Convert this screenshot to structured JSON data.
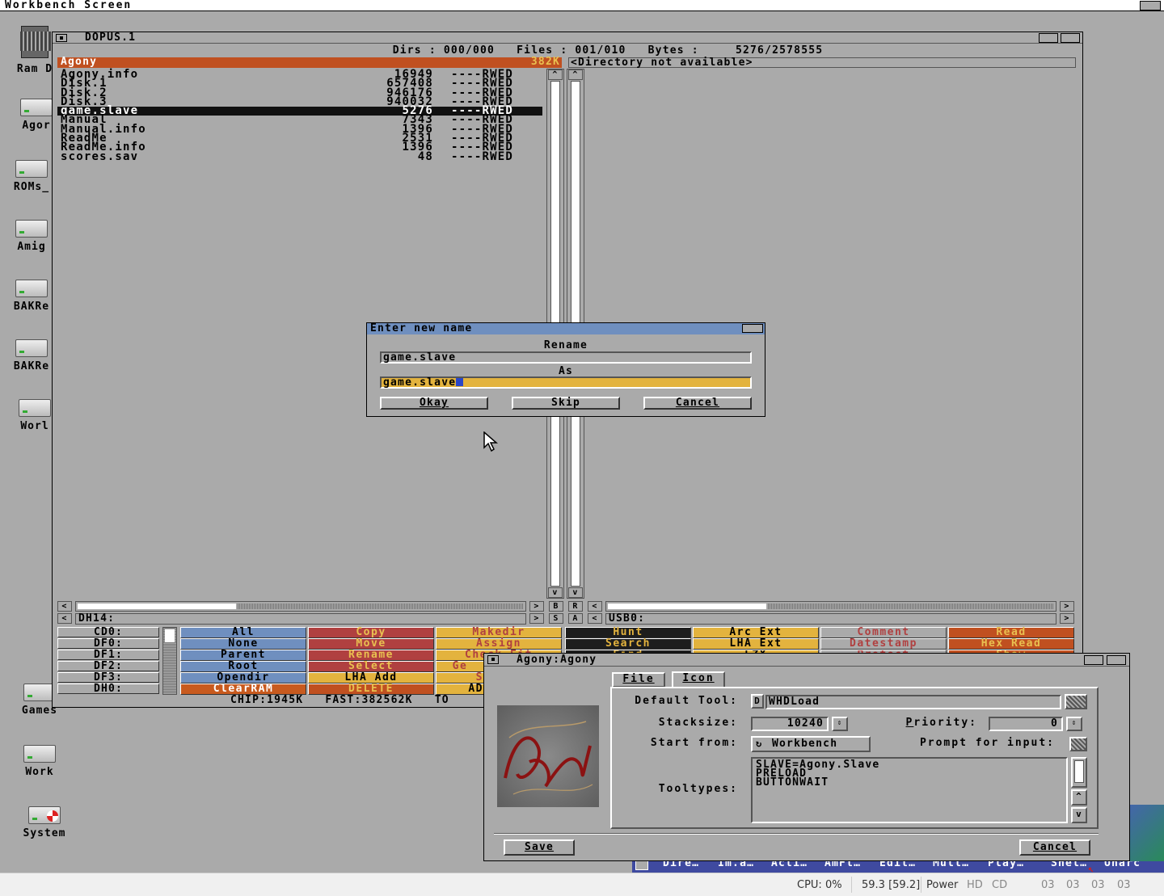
{
  "screen": {
    "title": "Workbench Screen"
  },
  "desktop_icons": [
    {
      "label": "Ram D",
      "icon": "ram-disk-icon"
    },
    {
      "label": "Agor",
      "icon": "harddisk-icon"
    },
    {
      "label": "ROMs_",
      "icon": "harddisk-icon"
    },
    {
      "label": "Amig",
      "icon": "harddisk-icon"
    },
    {
      "label": "BAKRe",
      "icon": "harddisk-icon"
    },
    {
      "label": "BAKRe",
      "icon": "harddisk-icon"
    },
    {
      "label": "Worl",
      "icon": "harddisk-icon"
    },
    {
      "label": "Games",
      "icon": "harddisk-icon"
    },
    {
      "label": "Work",
      "icon": "harddisk-icon"
    },
    {
      "label": "System",
      "icon": "system-disk-icon"
    }
  ],
  "dopus": {
    "title": "DOPUS.1",
    "status": "Dirs : 000/000   Files : 001/010   Bytes :     5276/2578555",
    "left_header": {
      "name": "Agony",
      "size": "382K"
    },
    "right_header": "<Directory not available>",
    "files": [
      {
        "name": "Agony.info",
        "size": "16949",
        "prot": "----RWED"
      },
      {
        "name": "Disk.1",
        "size": "657408",
        "prot": "----RWED"
      },
      {
        "name": "Disk.2",
        "size": "946176",
        "prot": "----RWED"
      },
      {
        "name": "Disk.3",
        "size": "940032",
        "prot": "----RWED"
      },
      {
        "name": "game.slave",
        "size": "5276",
        "prot": "----RWED",
        "selected": true
      },
      {
        "name": "Manual",
        "size": "7343",
        "prot": "----RWED"
      },
      {
        "name": "Manual.info",
        "size": "1396",
        "prot": "----RWED"
      },
      {
        "name": "ReadMe",
        "size": "2531",
        "prot": "----RWED"
      },
      {
        "name": "ReadMe.info",
        "size": "1396",
        "prot": "----RWED"
      },
      {
        "name": "scores.sav",
        "size": "48",
        "prot": "----RWED"
      }
    ],
    "left_path": "DH14:",
    "right_path": "USB0:",
    "mid_buttons": {
      "b": "B",
      "r": "R",
      "s": "S",
      "a": "A"
    },
    "drives": [
      "CD0:",
      "DF0:",
      "DF1:",
      "DF2:",
      "DF3:",
      "DH0:"
    ],
    "buttons": {
      "col1": [
        "All",
        "None",
        "Parent",
        "Root",
        "Opendir",
        "ClearRAM"
      ],
      "col2": [
        "Copy",
        "Move",
        "Rename",
        "Select",
        "LHA Add",
        "DELETE"
      ],
      "col3": [
        "Makedir",
        "Assign",
        "Check Fit",
        "Ge",
        "S",
        "AD"
      ],
      "col4": [
        "Hunt",
        "Search",
        "Find"
      ],
      "col5": [
        "Arc Ext",
        "LHA Ext",
        "LZX"
      ],
      "col6": [
        "Comment",
        "Datestamp",
        "Protect"
      ],
      "col7": [
        "Read",
        "Hex Read",
        "Show"
      ]
    },
    "memory": "CHIP:1945K   FAST:382562K   TO"
  },
  "dialog": {
    "title": "Enter new name",
    "rename_label": "Rename",
    "old_name": "game.slave",
    "as_label": "As",
    "new_name": "game.slave",
    "okay": "Okay",
    "skip": "Skip",
    "cancel": "Cancel"
  },
  "icon_window": {
    "title": "Agony:Agony",
    "tabs": [
      "File",
      "Icon"
    ],
    "default_tool_label": "Default Tool:",
    "default_tool": "WHDLoad",
    "stacksize_label": "Stacksize:",
    "stacksize": "10240",
    "priority_label": "Priority:",
    "priority": "0",
    "start_from_label": "Start from:",
    "start_from": "Workbench",
    "prompt_label": "Prompt for input:",
    "tooltypes_label": "Tooltypes:",
    "tooltypes": [
      "SLAVE=Agony.Slave",
      "PRELOAD",
      "BUTTONWAIT"
    ],
    "save": "Save",
    "cancel": "Cancel",
    "icon_image_text": "Agony"
  },
  "bottom_dock": [
    "Dire…",
    "Im.a…",
    "Acti…",
    "AmFt…",
    "Edit…",
    "Mult…",
    "Play…",
    "Shel…",
    "Unarc"
  ],
  "taskbar": {
    "cpu": "CPU: 0%",
    "fps": "59.3 [59.2]",
    "power": "Power",
    "hd": "HD",
    "cd": "CD",
    "df": [
      "03",
      "03",
      "03",
      "03"
    ]
  },
  "colors": {
    "dopus_orange": "#c05020",
    "title_blue": "#6f8fbf",
    "gold": "#e3b33e",
    "red": "#b04040"
  }
}
